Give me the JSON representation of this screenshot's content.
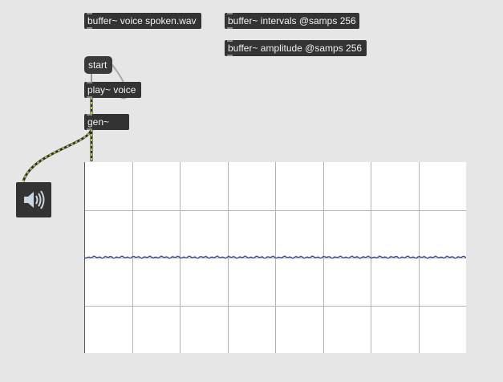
{
  "objects": {
    "buffer_voice": "buffer~ voice spoken.wav",
    "buffer_intervals": "buffer~ intervals @samps 256",
    "buffer_amplitude": "buffer~ amplitude @samps 256",
    "start_message": "start",
    "play_voice": "play~ voice",
    "gen": "gen~"
  },
  "speaker": {
    "icon": "speaker-icon",
    "state": "on"
  },
  "scope": {
    "grid_columns": 8,
    "grid_rows": 4,
    "line_color": "#3f4fa0",
    "grid_color": "#b5b5b5"
  },
  "colors": {
    "background": "#e6e6e6",
    "object_fill": "#333333",
    "signal_cord": "#b8c23a"
  }
}
